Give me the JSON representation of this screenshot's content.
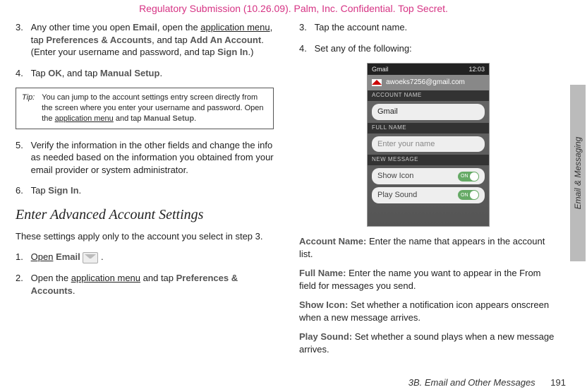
{
  "header": "Regulatory Submission (10.26.09). Palm, Inc. Confidential. Top Secret.",
  "side_tab": "Email & Messaging",
  "footer_section": "3B. Email and Other Messages",
  "footer_page": "191",
  "left": {
    "step3_num": "3.",
    "step3_a": "Any other time you open ",
    "step3_email": "Email",
    "step3_b": ", open the ",
    "step3_appmenu": "application menu",
    "step3_c": ", tap ",
    "step3_prefs": "Preferences & Accounts",
    "step3_d": ", and tap ",
    "step3_add": "Add An Account",
    "step3_e": ". (Enter your username and password, and tap ",
    "step3_signin": "Sign In",
    "step3_f": ".)",
    "step4_num": "4.",
    "step4_a": "Tap ",
    "step4_ok": "OK",
    "step4_b": ", and tap ",
    "step4_manual": "Manual Setup",
    "step4_c": ".",
    "tip_label": "Tip:",
    "tip_a": "You can jump to the account settings entry screen directly from the screen where you enter your username and password. Open the ",
    "tip_appmenu": "application menu",
    "tip_b": " and tap ",
    "tip_manual": "Manual Setup",
    "tip_c": ".",
    "step5_num": "5.",
    "step5": "Verify the information in the other fields and change the info as needed based on the information you obtained from your email provider or system administrator.",
    "step6_num": "6.",
    "step6_a": "Tap ",
    "step6_signin": "Sign In",
    "step6_b": ".",
    "section": "Enter Advanced Account Settings",
    "intro": "These settings apply only to the account you select in step 3.",
    "s1_num": "1.",
    "s1_open": "Open",
    "s1_email": "Email",
    "s1_dot": ".",
    "s2_num": "2.",
    "s2_a": "Open the ",
    "s2_appmenu": "application menu",
    "s2_b": " and tap ",
    "s2_prefs": "Preferences & Accounts",
    "s2_c": "."
  },
  "right": {
    "step3_num": "3.",
    "step3": "Tap the account name.",
    "step4_num": "4.",
    "step4": "Set any of the following:",
    "opt_account_label": "Account Name:",
    "opt_account": " Enter the name that appears in the account list.",
    "opt_fullname_label": "Full Name:",
    "opt_fullname": " Enter the name you want to appear in the From field for messages you send.",
    "opt_showicon_label": "Show Icon:",
    "opt_showicon": " Set whether a notification icon appears onscreen when a new message arrives.",
    "opt_playsound_label": "Play Sound:",
    "opt_playsound": " Set whether a sound plays when a new message arrives."
  },
  "phone": {
    "carrier": "Gmail",
    "time": "12:03",
    "address": "awoeks7256@gmail.com",
    "label_account": "ACCOUNT NAME",
    "field_account": "Gmail",
    "label_fullname": "FULL NAME",
    "field_fullname": "Enter your name",
    "label_newmsg": "NEW MESSAGE",
    "row_showicon": "Show Icon",
    "row_playsound": "Play Sound",
    "toggle_on": "ON"
  }
}
